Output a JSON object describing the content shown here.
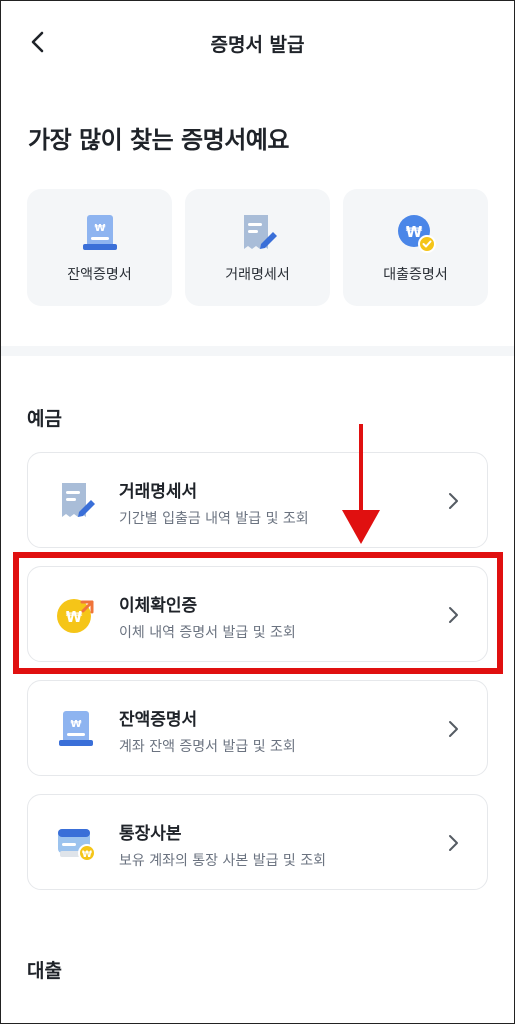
{
  "header": {
    "title": "증명서 발급"
  },
  "hero": {
    "title": "가장 많이 찾는 증명서예요"
  },
  "quick_cards": [
    {
      "label": "잔액증명서",
      "icon": "balance-certificate-icon"
    },
    {
      "label": "거래명세서",
      "icon": "transaction-statement-icon"
    },
    {
      "label": "대출증명서",
      "icon": "loan-certificate-icon"
    }
  ],
  "deposit": {
    "title": "예금",
    "items": [
      {
        "title": "거래명세서",
        "desc": "기간별 입출금 내역 발급 및 조회",
        "icon": "transaction-statement-icon"
      },
      {
        "title": "이체확인증",
        "desc": "이체 내역 증명서 발급 및 조회",
        "icon": "transfer-confirmation-icon"
      },
      {
        "title": "잔액증명서",
        "desc": "계좌 잔액 증명서 발급 및 조회",
        "icon": "balance-certificate-icon"
      },
      {
        "title": "통장사본",
        "desc": "보유 계좌의 통장 사본 발급 및 조회",
        "icon": "bankbook-copy-icon"
      }
    ]
  },
  "loan": {
    "title": "대출"
  },
  "colors": {
    "highlight": "#e01010",
    "card_bg": "#f4f6f8",
    "accent_blue": "#3a6fd8",
    "accent_yellow": "#f5c518"
  }
}
